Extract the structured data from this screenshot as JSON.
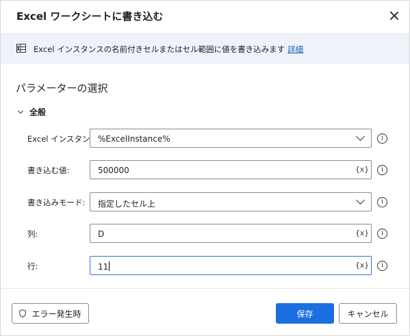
{
  "dialog": {
    "title": "Excel ワークシートに書き込む"
  },
  "banner": {
    "icon": "excel-icon",
    "description": "Excel インスタンスの名前付きセルまたはセル範囲に値を書き込みます",
    "link_label": "詳細"
  },
  "parameters": {
    "section_title": "パラメーターの選択",
    "group_label": "全般",
    "fields": [
      {
        "label": "Excel インスタンス:",
        "value": "%ExcelInstance%",
        "type": "dropdown"
      },
      {
        "label": "書き込む値:",
        "value": "500000",
        "type": "text",
        "var_button": "{x}"
      },
      {
        "label": "書き込みモード:",
        "value": "指定したセル上",
        "type": "dropdown"
      },
      {
        "label": "列:",
        "value": "D",
        "type": "text",
        "var_button": "{x}"
      },
      {
        "label": "行:",
        "value": "11",
        "type": "text",
        "var_button": "{x}"
      }
    ],
    "info_glyph": "i"
  },
  "footer": {
    "error_button": "エラー発生時",
    "save_button": "保存",
    "cancel_button": "キャンセル"
  },
  "colors": {
    "accent": "#1b6fe0",
    "banner_bg": "#eef3fa",
    "link": "#1a5fb4",
    "focus_border": "#3b6fd1"
  }
}
